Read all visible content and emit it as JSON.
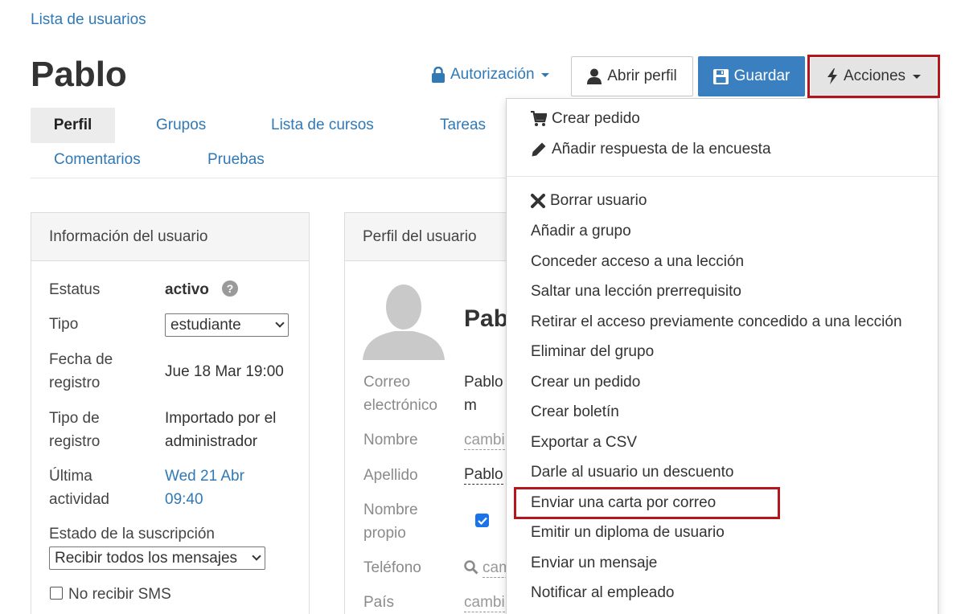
{
  "breadcrumb": "Lista de usuarios",
  "page_title": "Pablo",
  "header": {
    "auth_label": "Autorización",
    "open_profile_label": "Abrir perfil",
    "save_label": "Guardar",
    "actions_label": "Acciones"
  },
  "tabs": [
    {
      "label": "Perfil",
      "active": true
    },
    {
      "label": "Grupos"
    },
    {
      "label": "Lista de cursos"
    },
    {
      "label": "Tareas"
    },
    {
      "label": "Comentarios"
    },
    {
      "label": "Pruebas"
    }
  ],
  "user_info": {
    "title": "Información del usuario",
    "status_label": "Estatus",
    "status_value": "activo",
    "type_label": "Tipo",
    "type_value": "estudiante",
    "reg_date_label_1": "Fecha de",
    "reg_date_label_2": "registro",
    "reg_date_value": "Jue 18 Mar 19:00",
    "reg_type_label_1": "Tipo de",
    "reg_type_label_2": "registro",
    "reg_type_value_1": "Importado por el",
    "reg_type_value_2": "administrador",
    "last_activity_label_1": "Última",
    "last_activity_label_2": "actividad",
    "last_activity_value_1": "Wed 21 Abr",
    "last_activity_value_2": "09:40",
    "subscription_label": "Estado de la suscripción",
    "subscription_value": "Recibir todos los mensajes",
    "no_sms_label": "No recibir SMS"
  },
  "profile": {
    "title": "Perfil del usuario",
    "name_heading": "Pablo",
    "email_label_1": "Correo",
    "email_label_2": "electrónico",
    "email_value_1": "Pablo",
    "email_value_2": "m",
    "first_name_label": "Nombre",
    "first_name_value": "cambi",
    "last_name_label": "Apellido",
    "last_name_value": "Pablo",
    "own_name_label_1": "Nombre",
    "own_name_label_2": "propio",
    "phone_label": "Teléfono",
    "phone_value": "cam",
    "country_label": "País",
    "country_value": "cambi"
  },
  "actions_menu": {
    "group1": [
      "Crear pedido",
      "Añadir respuesta de la encuesta"
    ],
    "group2": [
      "Borrar usuario",
      "Añadir a grupo",
      "Conceder acceso a una lección",
      "Saltar una lección prerrequisito",
      "Retirar el acceso previamente concedido a una lección",
      "Eliminar del grupo",
      "Crear un pedido",
      "Crear boletín",
      "Exportar a CSV",
      "Darle al usuario un descuento",
      "Enviar una carta por correo",
      "Emitir un diploma de usuario",
      "Enviar un mensaje",
      "Notificar al empleado"
    ]
  },
  "colors": {
    "link": "#3079b5",
    "primary": "#3a7fc0",
    "highlight": "#b3161c"
  }
}
